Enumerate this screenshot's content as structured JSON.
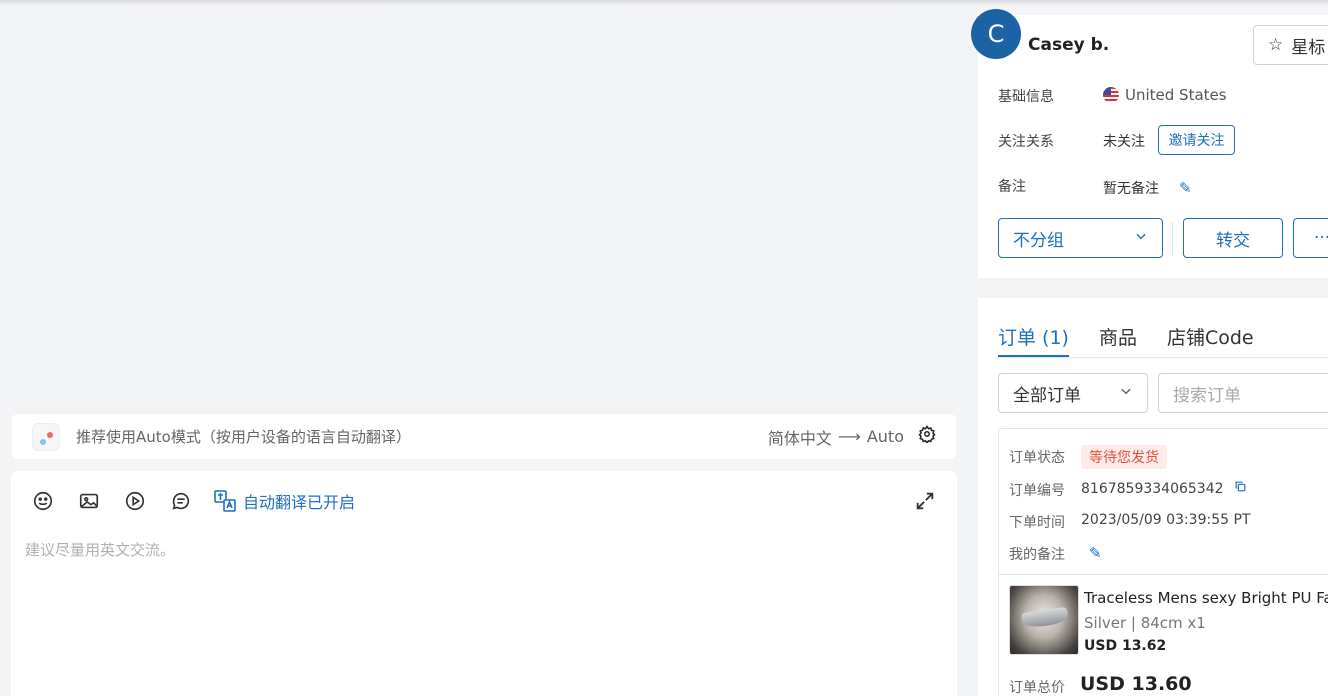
{
  "translate_hint": {
    "text": "推荐使用Auto模式（按用户设备的语言自动翻译）",
    "source_lang": "简体中文",
    "arrow": "⟶",
    "target_lang": "Auto"
  },
  "composer": {
    "auto_translate_label": "自动翻译已开启",
    "placeholder": "建议尽量用英文交流。"
  },
  "profile": {
    "avatar_letter": "C",
    "name": "Casey b.",
    "star_label": "星标",
    "basic_info_label": "基础信息",
    "country": "United States",
    "follow_label": "关注关系",
    "follow_status": "未关注",
    "invite_label": "邀请关注",
    "note_label": "备注",
    "note_value": "暂无备注",
    "group_value": "不分组",
    "transfer_label": "转交",
    "more_label": "···"
  },
  "orders": {
    "tabs": [
      "订单 (1)",
      "商品",
      "店铺Code"
    ],
    "filter_value": "全部订单",
    "search_placeholder": "搜索订单",
    "status_label": "订单状态",
    "status_value": "等待您发货",
    "number_label": "订单编号",
    "number_value": "8167859334065342",
    "time_label": "下单时间",
    "time_value": "2023/05/09 03:39:55 PT",
    "my_note_label": "我的备注",
    "product": {
      "title": "Traceless Mens sexy Bright PU Faux",
      "variant": "Silver | 84cm x1",
      "price": "USD 13.62"
    },
    "total_label": "订单总价",
    "total_value": "USD 13.60"
  },
  "colors": {
    "accent": "#1f6fc5",
    "avatar_bg": "#1e62a6",
    "status_text": "#e0533b",
    "status_bg": "#fdecea"
  }
}
